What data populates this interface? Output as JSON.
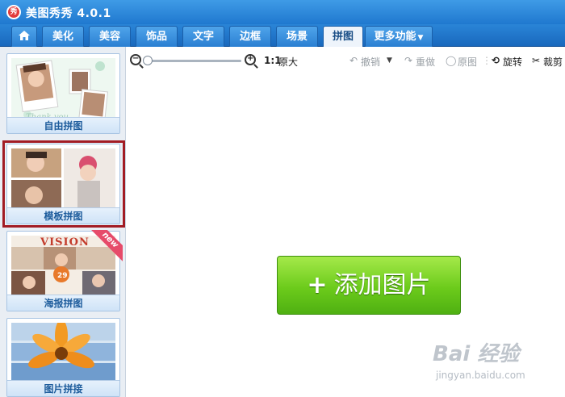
{
  "window": {
    "title": "美图秀秀 4.0.1",
    "logo_text": "秀"
  },
  "tabs": [
    {
      "label": "美化"
    },
    {
      "label": "美容"
    },
    {
      "label": "饰品"
    },
    {
      "label": "文字"
    },
    {
      "label": "边框"
    },
    {
      "label": "场景"
    },
    {
      "label": "拼图"
    },
    {
      "label": "更多功能"
    }
  ],
  "active_tab": "拼图",
  "sidebar": {
    "items": [
      {
        "label": "自由拼图"
      },
      {
        "label": "模板拼图",
        "selected": true
      },
      {
        "label": "海报拼图",
        "badge": "new",
        "poster_text": "VISION",
        "poster_number": "29"
      },
      {
        "label": "图片拼接"
      }
    ]
  },
  "toolbar": {
    "zoom_ratio": "1:1",
    "original_size": "原大",
    "undo": "撤销",
    "redo": "重做",
    "original": "原图",
    "rotate": "旋转",
    "crop": "裁剪"
  },
  "canvas": {
    "add_button": "添加图片",
    "add_symbol": "+"
  },
  "watermark": {
    "text": "Bai 经验",
    "sub": "jingyan.baidu.com"
  },
  "colors": {
    "accent_blue": "#2a85d7",
    "selection_red": "#a21c24",
    "add_green": "#6ccb1b"
  }
}
